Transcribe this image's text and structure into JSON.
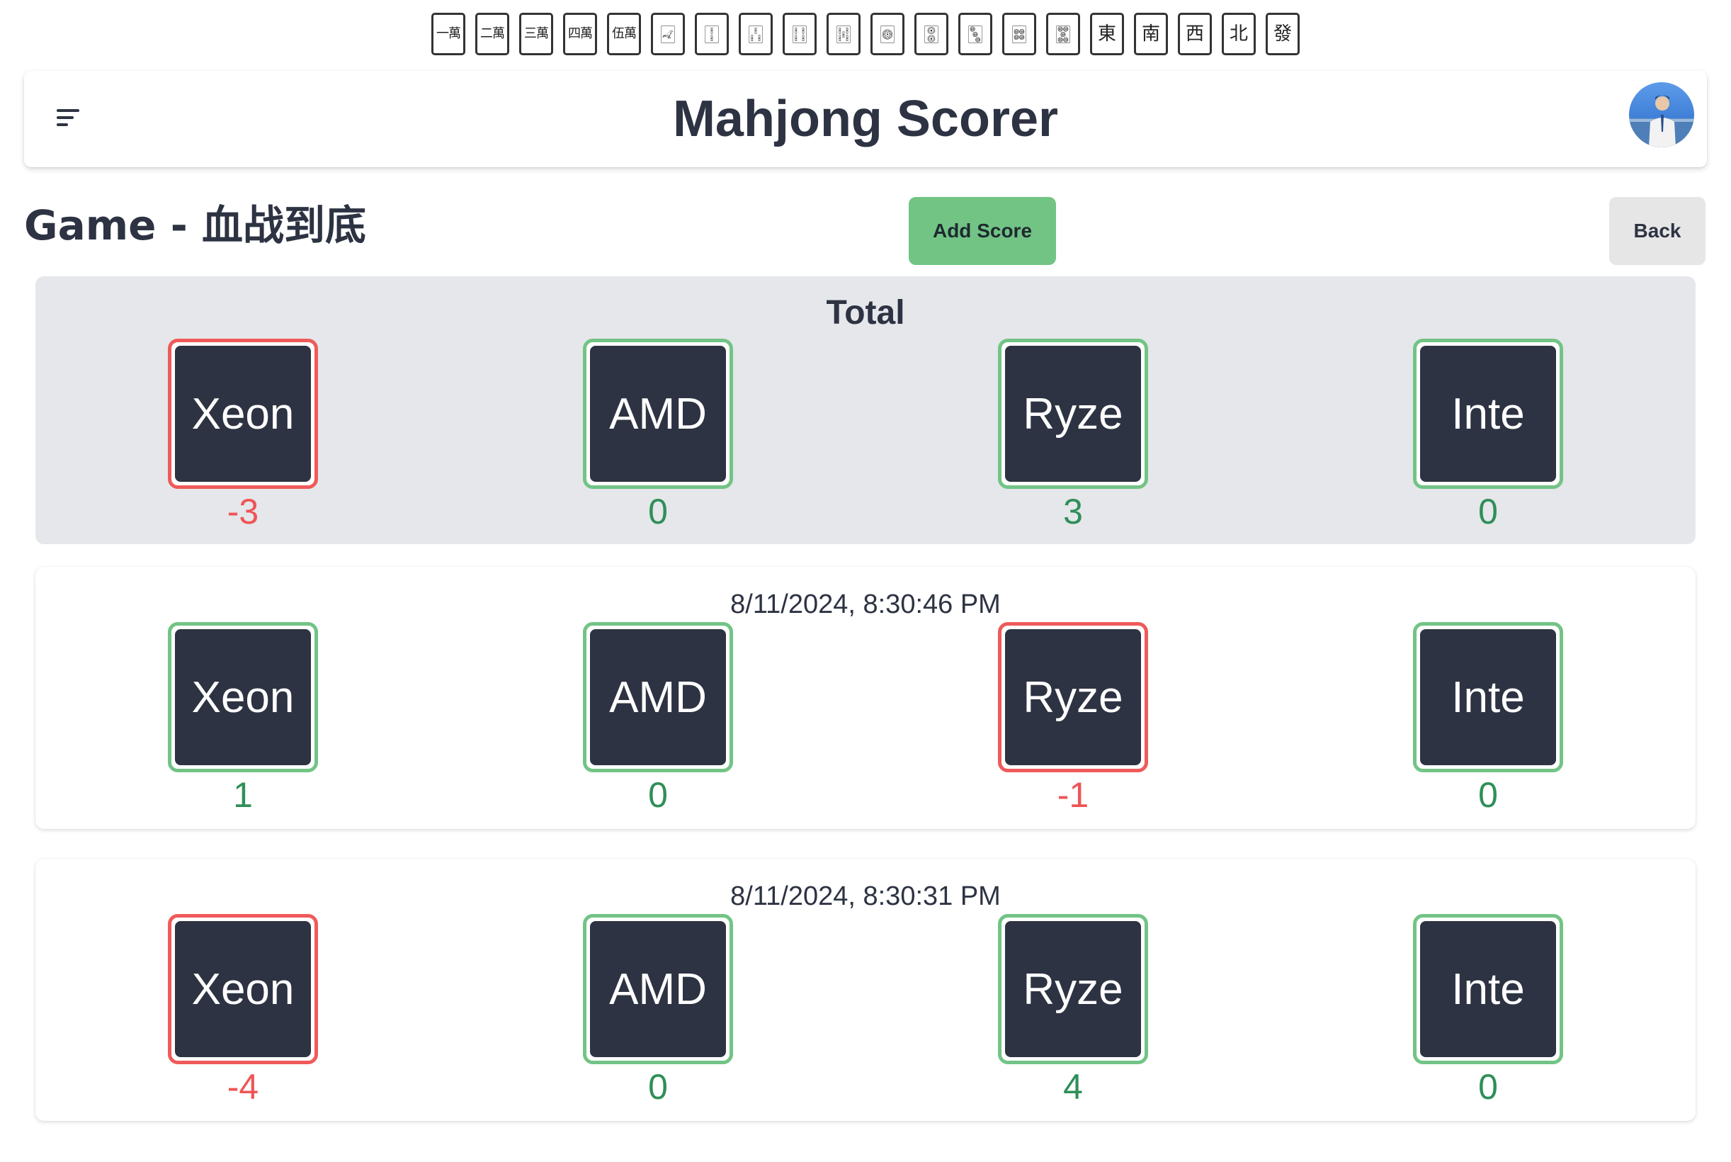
{
  "tiles": [
    "一萬",
    "二萬",
    "三萬",
    "四萬",
    "伍萬",
    "🀐",
    "🀑",
    "🀒",
    "🀓",
    "🀔",
    "🀙",
    "🀚",
    "🀛",
    "🀜",
    "🀝",
    "東",
    "南",
    "西",
    "北",
    "發"
  ],
  "header": {
    "title": "Mahjong Scorer",
    "menu_icon": "hamburger-menu-icon",
    "avatar": "user-avatar"
  },
  "game": {
    "title": "Game - 血战到底",
    "add_score_label": "Add Score",
    "back_label": "Back"
  },
  "colors": {
    "positive": "#72c485",
    "negative": "#f05a5a",
    "card_bg": "#2d3342"
  },
  "total": {
    "heading": "Total",
    "players": [
      {
        "name": "Xeon",
        "score": "-3"
      },
      {
        "name": "AMD",
        "score": "0"
      },
      {
        "name": "Ryze",
        "score": "3"
      },
      {
        "name": "Inte",
        "score": "0"
      }
    ]
  },
  "rounds": [
    {
      "timestamp": "8/11/2024, 8:30:46 PM",
      "players": [
        {
          "name": "Xeon",
          "score": "1"
        },
        {
          "name": "AMD",
          "score": "0"
        },
        {
          "name": "Ryze",
          "score": "-1"
        },
        {
          "name": "Inte",
          "score": "0"
        }
      ]
    },
    {
      "timestamp": "8/11/2024, 8:30:31 PM",
      "players": [
        {
          "name": "Xeon",
          "score": "-4"
        },
        {
          "name": "AMD",
          "score": "0"
        },
        {
          "name": "Ryze",
          "score": "4"
        },
        {
          "name": "Inte",
          "score": "0"
        }
      ]
    }
  ]
}
